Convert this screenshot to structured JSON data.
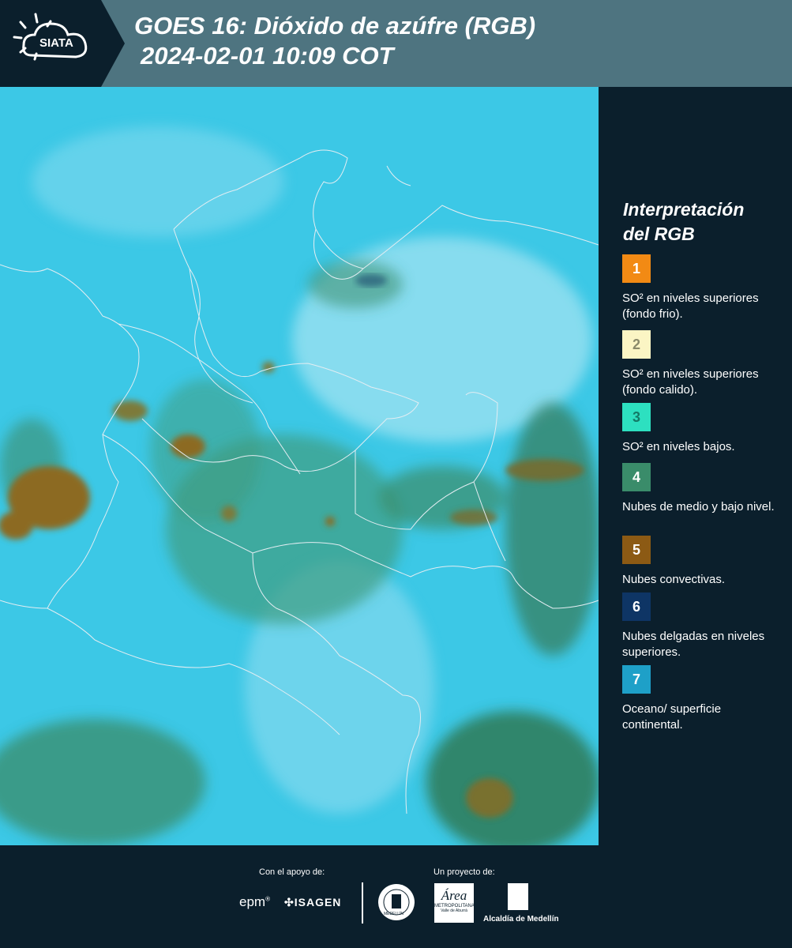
{
  "header": {
    "logo_text": "SIATA",
    "title_line1": "GOES 16: Dióxido de azúfre (RGB)",
    "title_line2": "2024-02-01 10:09 COT"
  },
  "map": {
    "background_color": "#3fc9e6",
    "border_color": "#dfe9ee",
    "cloud_colors": {
      "mid_low": "#3a8c6a",
      "convective": "#8c6b22",
      "ocean": "#1ea0c8"
    }
  },
  "legend": {
    "title_line1": "Interpretación",
    "title_line2": "del RGB",
    "items": [
      {
        "number": "1",
        "color": "#f28a14",
        "label": "SO² en niveles superiores (fondo frio)."
      },
      {
        "number": "2",
        "color": "#fbf5c4",
        "label": "SO² en niveles superiores (fondo calido)."
      },
      {
        "number": "3",
        "color": "#2de0c0",
        "label": "SO² en niveles bajos."
      },
      {
        "number": "4",
        "color": "#3a8c6a",
        "label": "Nubes de medio y bajo nivel."
      },
      {
        "number": "5",
        "color": "#8c5a14",
        "label": "Nubes convectivas."
      },
      {
        "number": "6",
        "color": "#0e3565",
        "label": "Nubes delgadas en niveles superiores."
      },
      {
        "number": "7",
        "color": "#1ea0c8",
        "label": "Oceano/ superficie continental."
      }
    ]
  },
  "footer": {
    "support_label": "Con el apoyo de:",
    "project_label": "Un proyecto de:",
    "sponsors": {
      "epm": "epm",
      "isagen": "ISAGEN"
    },
    "partners": {
      "area": "Área",
      "area_sub": "METROPOLITANA",
      "area_sub2": "Valle de Aburrá",
      "alcaldia": "Alcaldía de Medellín",
      "medellin_seal": "MEDELLÍN"
    }
  }
}
